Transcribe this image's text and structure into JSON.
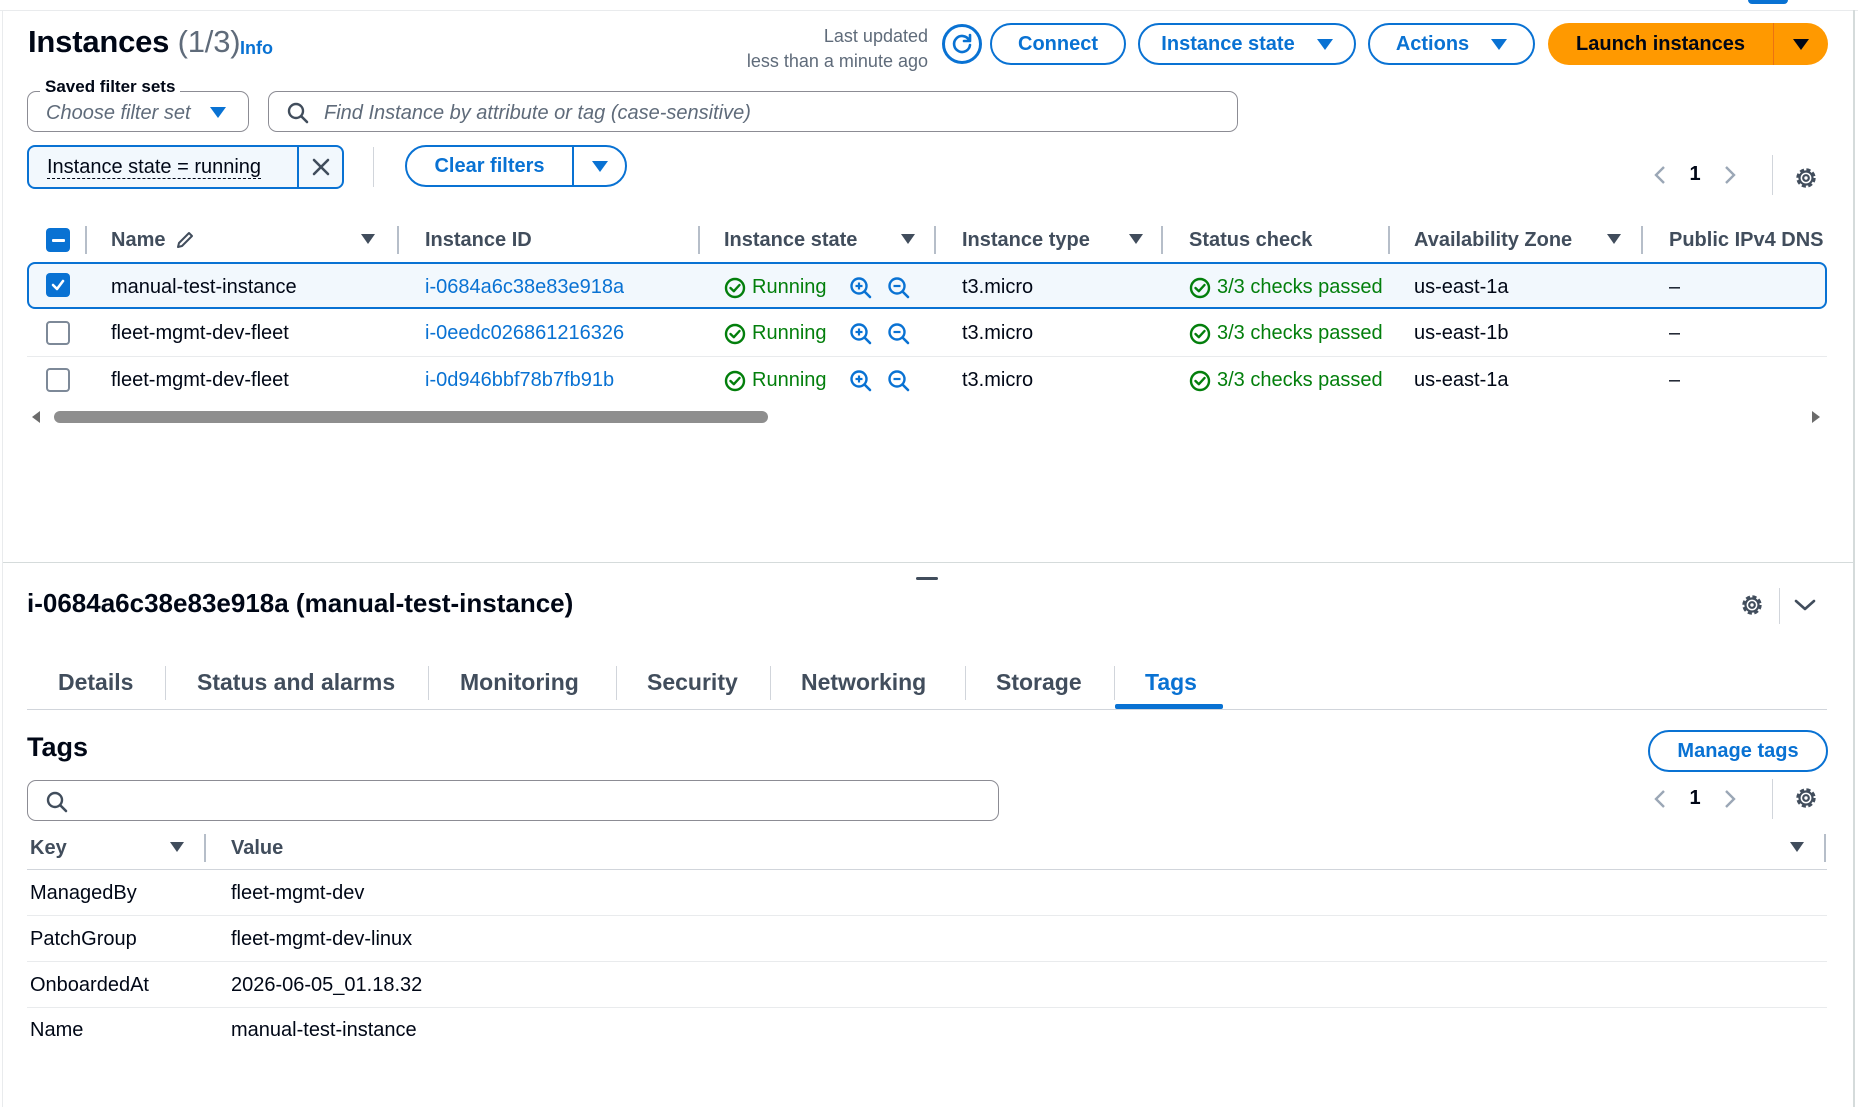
{
  "colors": {
    "accent": "#0972d3",
    "primary_button": "#ff9900",
    "success": "#037f0c",
    "text": "#000716",
    "muted": "#5f6b7a"
  },
  "header": {
    "title": "Instances",
    "count": "(1/3)",
    "info_link": "Info",
    "last_updated_line1": "Last updated",
    "last_updated_line2": "less than a minute ago",
    "refresh_icon": "refresh-icon",
    "buttons": {
      "connect": "Connect",
      "instance_state": "Instance state",
      "actions": "Actions",
      "launch": "Launch instances"
    }
  },
  "filters": {
    "saved_label": "Saved filter sets",
    "saved_placeholder": "Choose filter set",
    "search_placeholder": "Find Instance by attribute or tag (case-sensitive)",
    "token": "Instance state = running",
    "clear_label": "Clear filters"
  },
  "pagination": {
    "page": "1"
  },
  "table": {
    "columns": [
      "Name",
      "Instance ID",
      "Instance state",
      "Instance type",
      "Status check",
      "Availability Zone",
      "Public IPv4 DNS"
    ],
    "rows": [
      {
        "selected": true,
        "name": "manual-test-instance",
        "id": "i-0684a6c38e83e918a",
        "state": "Running",
        "type": "t3.micro",
        "status": "3/3 checks passed",
        "zone": "us-east-1a",
        "dns": "–"
      },
      {
        "selected": false,
        "name": "fleet-mgmt-dev-fleet",
        "id": "i-0eedc026861216326",
        "state": "Running",
        "type": "t3.micro",
        "status": "3/3 checks passed",
        "zone": "us-east-1b",
        "dns": "–"
      },
      {
        "selected": false,
        "name": "fleet-mgmt-dev-fleet",
        "id": "i-0d946bbf78b7fb91b",
        "state": "Running",
        "type": "t3.micro",
        "status": "3/3 checks passed",
        "zone": "us-east-1a",
        "dns": "–"
      }
    ]
  },
  "detail": {
    "title": "i-0684a6c38e83e918a (manual-test-instance)",
    "tabs": [
      "Details",
      "Status and alarms",
      "Monitoring",
      "Security",
      "Networking",
      "Storage",
      "Tags"
    ],
    "active_tab": "Tags",
    "tags_title": "Tags",
    "manage_tags": "Manage tags",
    "tags_columns": [
      "Key",
      "Value"
    ],
    "tags": [
      {
        "key": "ManagedBy",
        "value": "fleet-mgmt-dev"
      },
      {
        "key": "PatchGroup",
        "value": "fleet-mgmt-dev-linux"
      },
      {
        "key": "OnboardedAt",
        "value": "2026-06-05_01.18.32"
      },
      {
        "key": "Name",
        "value": "manual-test-instance"
      }
    ],
    "tags_page": "1"
  }
}
